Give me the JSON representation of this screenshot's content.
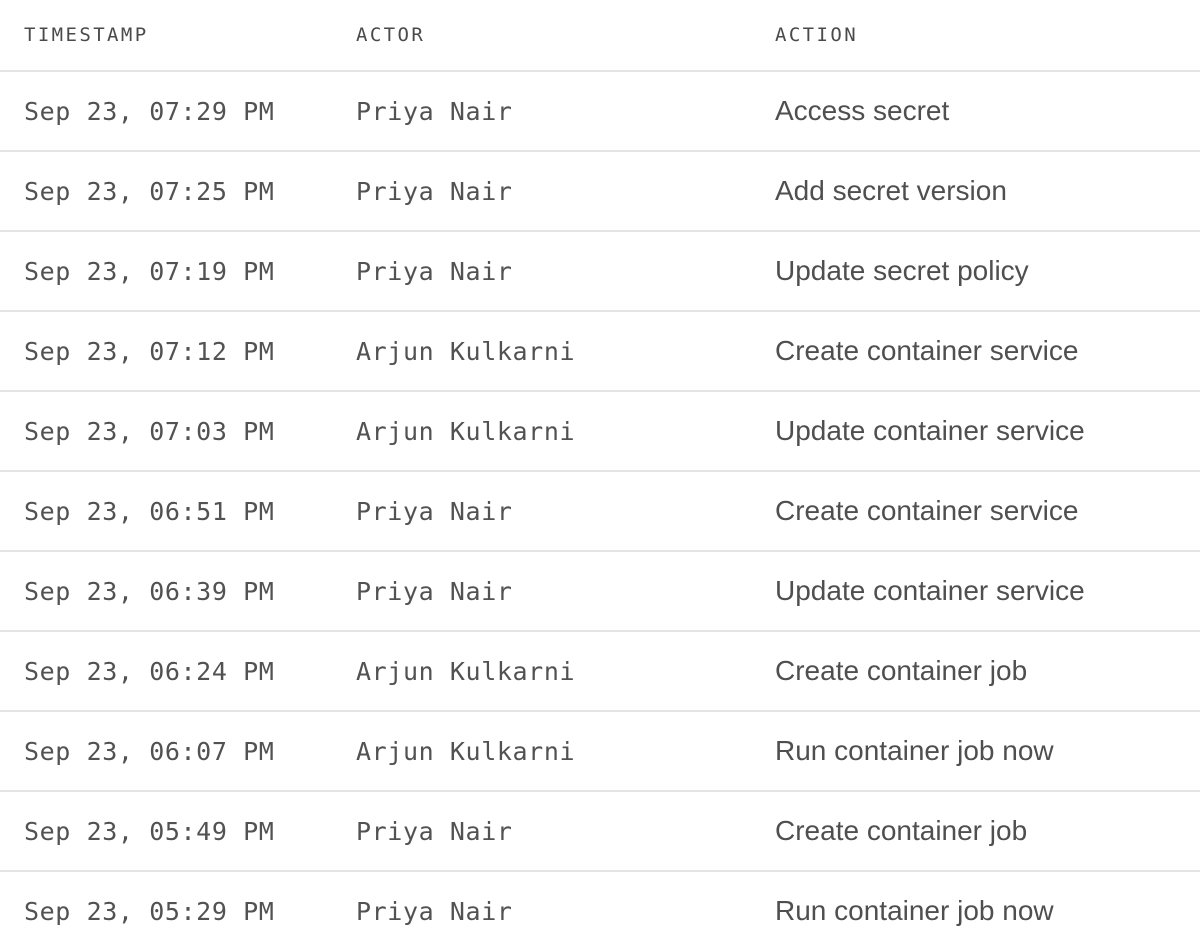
{
  "columns": {
    "timestamp": "TIMESTAMP",
    "actor": "ACTOR",
    "action": "ACTION"
  },
  "rows": [
    {
      "timestamp": "Sep 23, 07:29 PM",
      "actor": "Priya Nair",
      "action": "Access secret"
    },
    {
      "timestamp": "Sep 23, 07:25 PM",
      "actor": "Priya Nair",
      "action": "Add secret version"
    },
    {
      "timestamp": "Sep 23, 07:19 PM",
      "actor": "Priya Nair",
      "action": "Update secret policy"
    },
    {
      "timestamp": "Sep 23, 07:12 PM",
      "actor": "Arjun Kulkarni",
      "action": "Create container service"
    },
    {
      "timestamp": "Sep 23, 07:03 PM",
      "actor": "Arjun Kulkarni",
      "action": "Update container service"
    },
    {
      "timestamp": "Sep 23, 06:51 PM",
      "actor": "Priya Nair",
      "action": "Create container service"
    },
    {
      "timestamp": "Sep 23, 06:39 PM",
      "actor": "Priya Nair",
      "action": "Update container service"
    },
    {
      "timestamp": "Sep 23, 06:24 PM",
      "actor": "Arjun Kulkarni",
      "action": "Create container job"
    },
    {
      "timestamp": "Sep 23, 06:07 PM",
      "actor": "Arjun Kulkarni",
      "action": "Run container job now"
    },
    {
      "timestamp": "Sep 23, 05:49 PM",
      "actor": "Priya Nair",
      "action": "Create container job"
    },
    {
      "timestamp": "Sep 23, 05:29 PM",
      "actor": "Priya Nair",
      "action": "Run container job now"
    }
  ]
}
